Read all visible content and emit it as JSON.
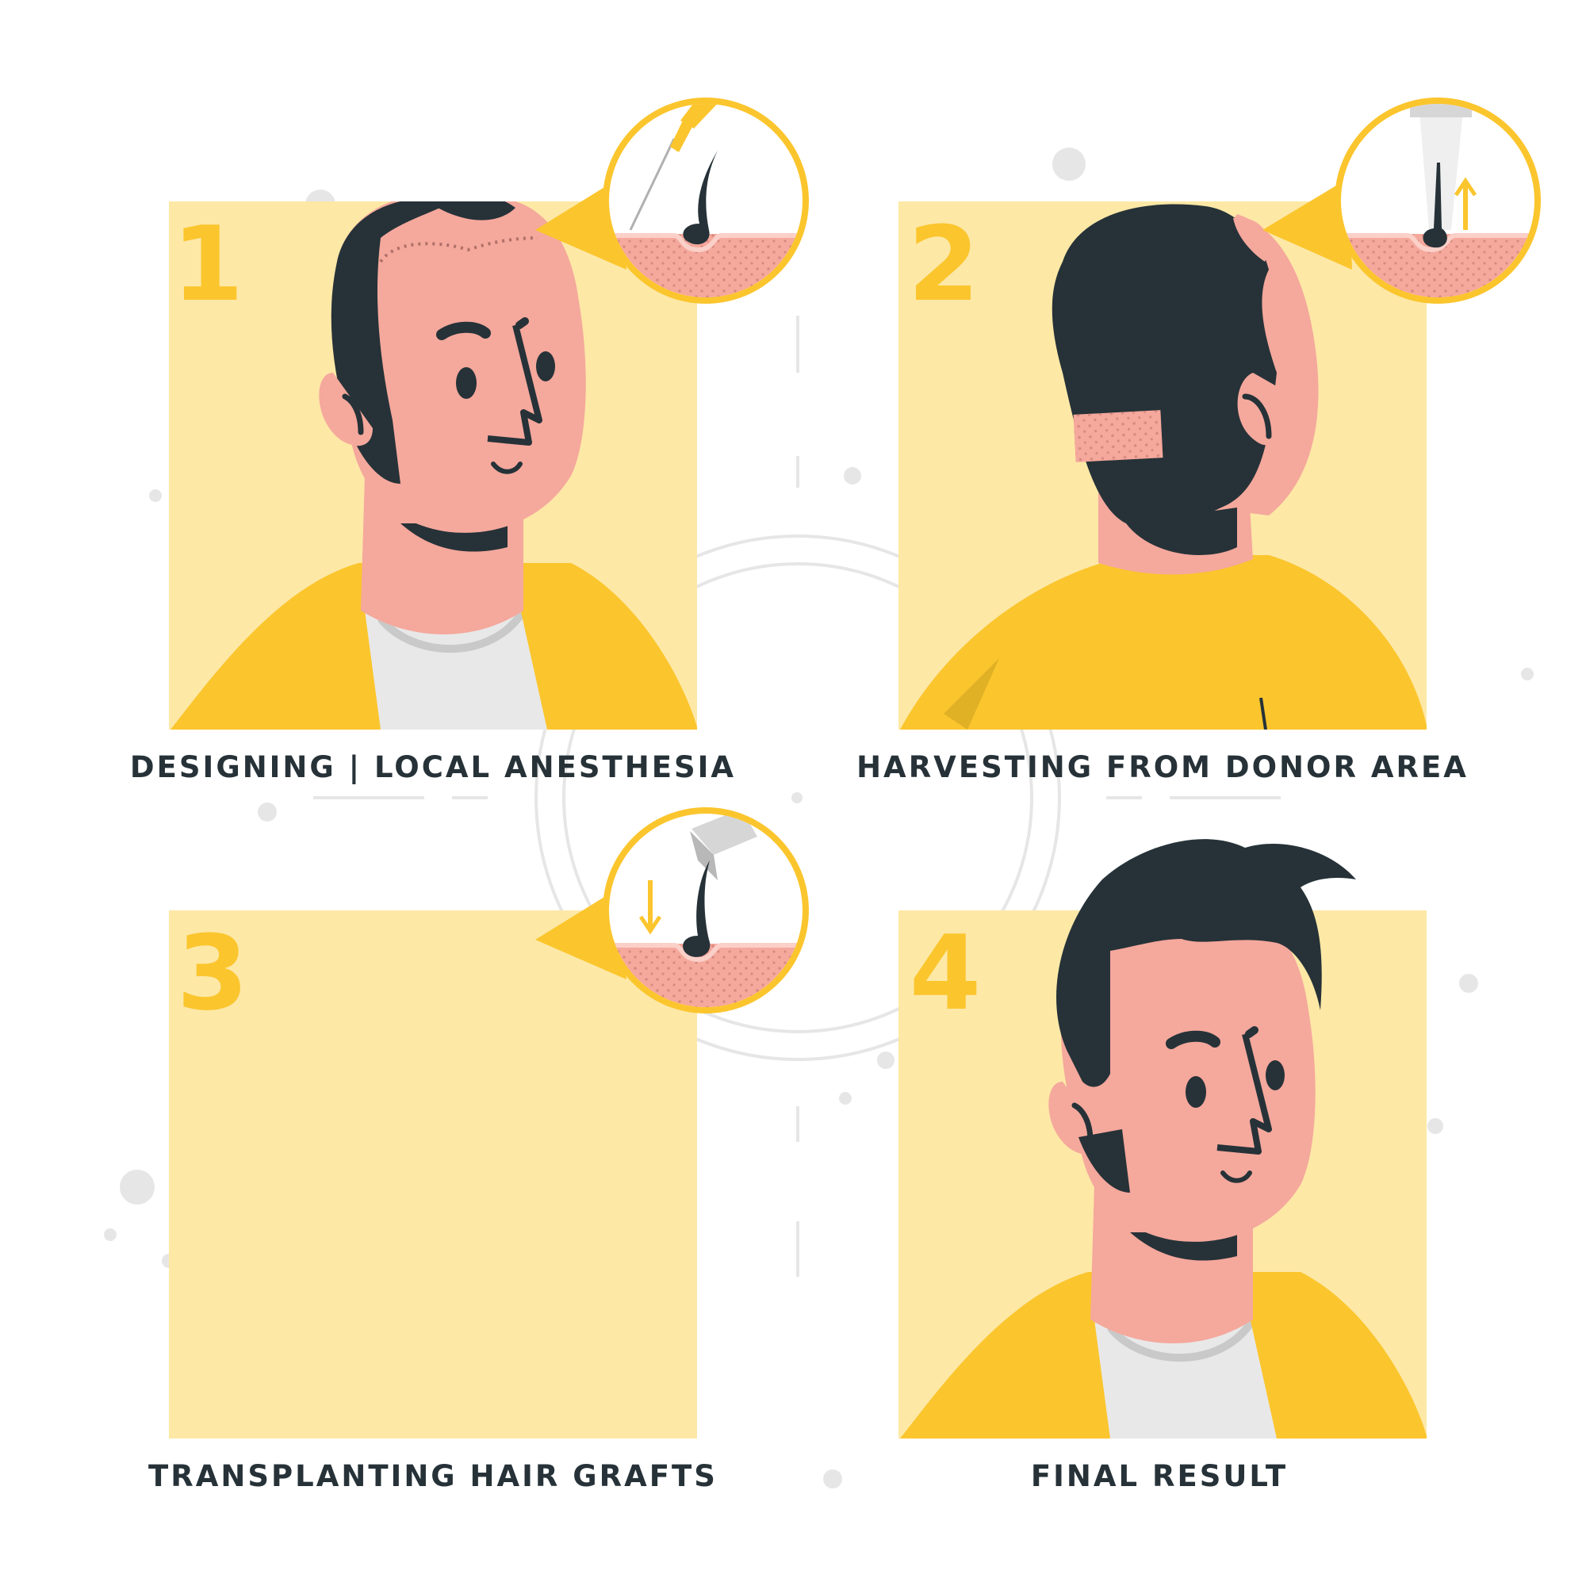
{
  "colors": {
    "panel": "#FDE8A6",
    "accent": "#FBC52D",
    "skin": "#F5A89C",
    "hair": "#263238",
    "shirt": "#E8E8E8",
    "scalp_dots": "#D98A80",
    "decor": "#E6E6E6",
    "text": "#263238"
  },
  "steps": [
    {
      "number": "1",
      "label": "DESIGNING | LOCAL ANESTHESIA",
      "icon": "syringe-icon"
    },
    {
      "number": "2",
      "label": "HARVESTING FROM DONOR AREA",
      "icon": "extraction-punch-icon"
    },
    {
      "number": "3",
      "label": "TRANSPLANTING HAIR GRAFTS",
      "icon": "implanter-icon"
    },
    {
      "number": "4",
      "label": "FINAL RESULT",
      "icon": ""
    }
  ]
}
